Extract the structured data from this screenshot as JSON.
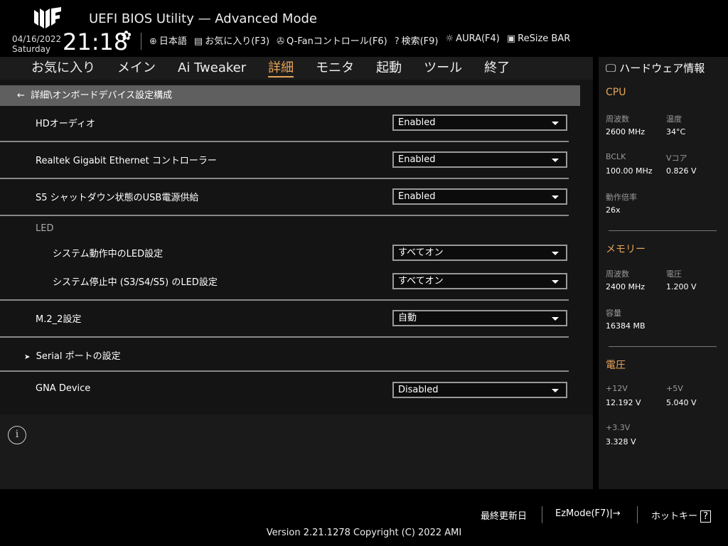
{
  "header": {
    "title": "UEFI BIOS Utility — Advanced Mode",
    "date": "04/16/2022",
    "day": "Saturday",
    "time": "21:18"
  },
  "toolbar": [
    {
      "icon": "globe-icon",
      "glyph": "⊕",
      "label": "日本語"
    },
    {
      "icon": "favorites-icon",
      "glyph": "▤",
      "label": "お気に入り(F3)"
    },
    {
      "icon": "fan-icon",
      "glyph": "✇",
      "label": "Q-Fanコントロール(F6)"
    },
    {
      "icon": "search-help-icon",
      "glyph": "?",
      "label": "検索(F9)"
    },
    {
      "icon": "aura-icon",
      "glyph": "☼",
      "label": "AURA(F4)"
    },
    {
      "icon": "resize-bar-icon",
      "glyph": "▣",
      "label": "ReSize BAR"
    }
  ],
  "tabs": [
    "お気に入り",
    "メイン",
    "Ai Tweaker",
    "詳細",
    "モニタ",
    "起動",
    "ツール",
    "終了"
  ],
  "active_tab": "詳細",
  "breadcrumb": "詳細\\オンボードデバイス設定構成",
  "settings": {
    "hd_audio": {
      "label": "HDオーディオ",
      "value": "Enabled"
    },
    "realtek": {
      "label": "Realtek Gigabit Ethernet コントローラー",
      "value": "Enabled"
    },
    "s5_usb": {
      "label": "S5 シャットダウン状態のUSB電源供給",
      "value": "Enabled"
    },
    "led_section": "LED",
    "led_run": {
      "label": "システム動作中のLED設定",
      "value": "すべてオン"
    },
    "led_stop": {
      "label": "システム停止中 (S3/S4/S5) のLED設定",
      "value": "すべてオン"
    },
    "m2": {
      "label": "M.2_2設定",
      "value": "自動"
    },
    "serial": {
      "label": "Serial ポートの設定"
    },
    "gna": {
      "label": "GNA Device",
      "value": "Disabled"
    }
  },
  "hw": {
    "title": "ハードウェア情報",
    "cpu": {
      "title": "CPU",
      "freq_l": "周波数",
      "freq": "2600 MHz",
      "temp_l": "温度",
      "temp": "34°C",
      "bclk_l": "BCLK",
      "bclk": "100.00 MHz",
      "vcore_l": "Vコア",
      "vcore": "0.826 V",
      "ratio_l": "動作倍率",
      "ratio": "26x"
    },
    "mem": {
      "title": "メモリー",
      "freq_l": "周波数",
      "freq": "2400 MHz",
      "volt_l": "電圧",
      "volt": "1.200 V",
      "cap_l": "容量",
      "cap": "16384 MB"
    },
    "volt": {
      "title": "電圧",
      "v12_l": "+12V",
      "v12": "12.192 V",
      "v5_l": "+5V",
      "v5": "5.040 V",
      "v33_l": "+3.3V",
      "v33": "3.328 V"
    }
  },
  "footer": {
    "last_modified": "最終更新日",
    "ezmode": "EzMode(F7)|→",
    "hotkeys": "ホットキー",
    "version": "Version 2.21.1278 Copyright (C) 2022 AMI"
  },
  "colors": {
    "accent": "#e8a45a"
  }
}
